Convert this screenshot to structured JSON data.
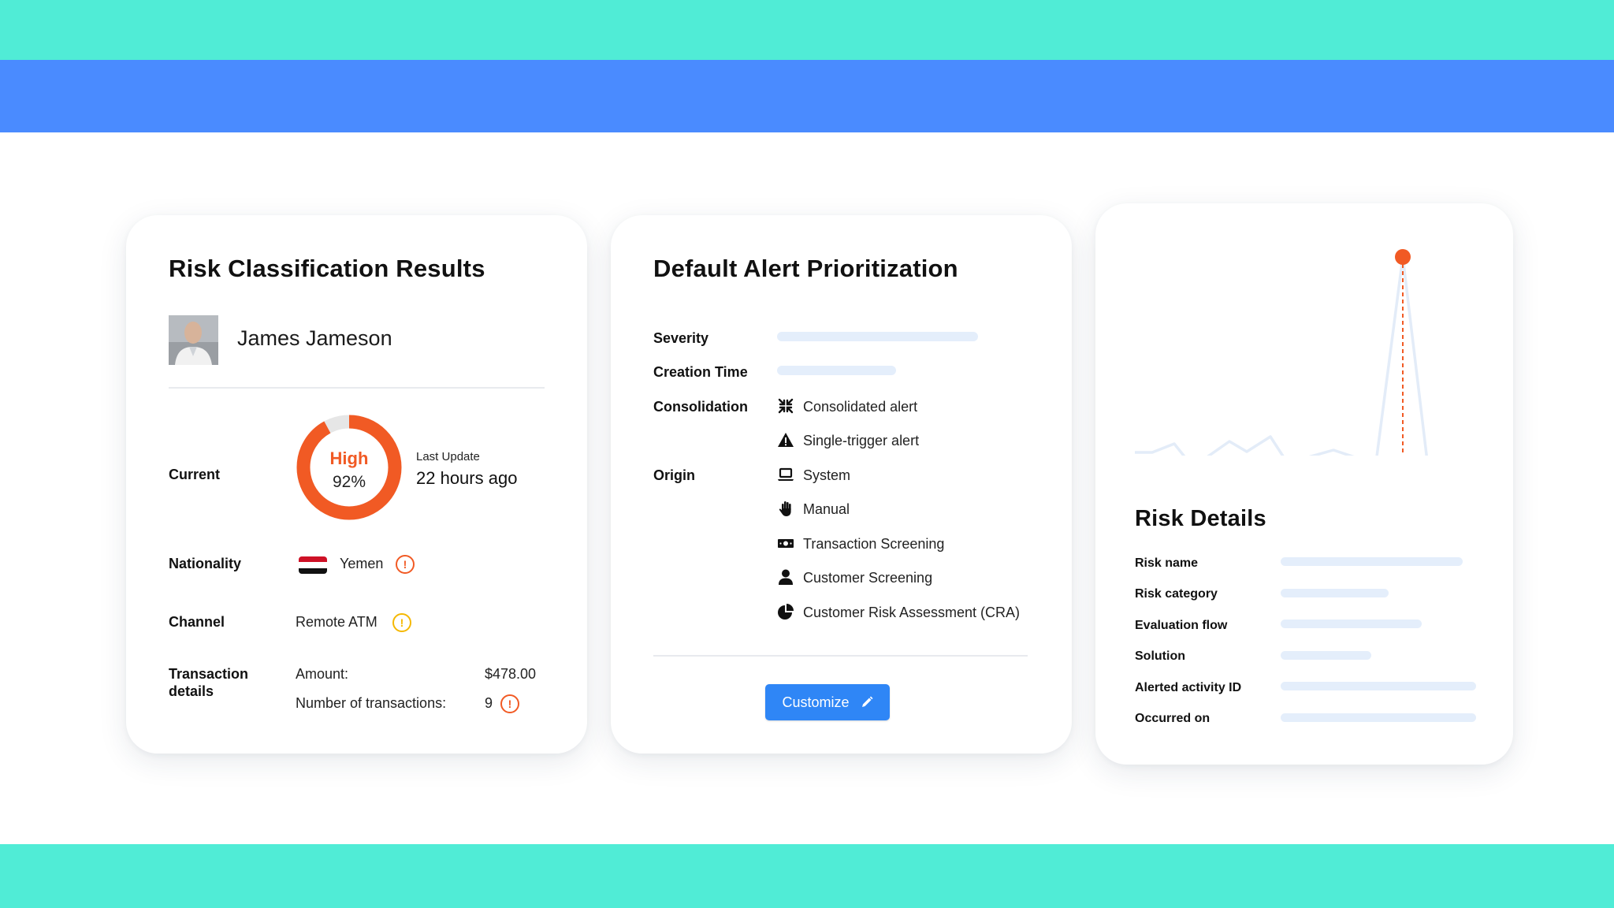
{
  "colors": {
    "top_band": "#50ecd6",
    "blue_band": "#4a8bff",
    "accent_orange": "#f15a24",
    "warning_yellow": "#f5b800",
    "skeleton": "#e4eefb",
    "button_blue": "#2f86f6"
  },
  "risk_card": {
    "title": "Risk Classification Results",
    "person_name": "James Jameson",
    "current_label": "Current",
    "risk_level": "High",
    "risk_percent_text": "92%",
    "risk_fraction": 0.92,
    "last_update_label": "Last Update",
    "last_update_value": "22 hours ago",
    "nationality_label": "Nationality",
    "nationality_value": "Yemen",
    "channel_label": "Channel",
    "channel_value": "Remote ATM",
    "transaction_label_line1": "Transaction",
    "transaction_label_line2": "details",
    "amount_label": "Amount:",
    "amount_value": "$478.00",
    "count_label": "Number of transactions:",
    "count_value": "9",
    "alert_glyph": "!"
  },
  "alert_card": {
    "title": "Default Alert Prioritization",
    "severity_label": "Severity",
    "creation_time_label": "Creation Time",
    "consolidation_label": "Consolidation",
    "origin_label": "Origin",
    "consolidation_items": [
      {
        "label": "Consolidated alert",
        "icon": "compress-arrows-icon"
      },
      {
        "label": "Single-trigger alert",
        "icon": "warning-triangle-icon"
      }
    ],
    "origin_items": [
      {
        "label": "System",
        "icon": "laptop-icon"
      },
      {
        "label": "Manual",
        "icon": "hand-icon"
      },
      {
        "label": "Transaction Screening",
        "icon": "money-bill-icon"
      },
      {
        "label": "Customer Screening",
        "icon": "person-icon"
      },
      {
        "label": "Customer Risk Assessment (CRA)",
        "icon": "pie-chart-icon"
      }
    ],
    "customize_label": "Customize"
  },
  "details_card": {
    "title": "Risk Details",
    "fields": [
      "Risk name",
      "Risk category",
      "Evaluation flow",
      "Solution",
      "Alerted activity ID",
      "Occurred on"
    ]
  }
}
